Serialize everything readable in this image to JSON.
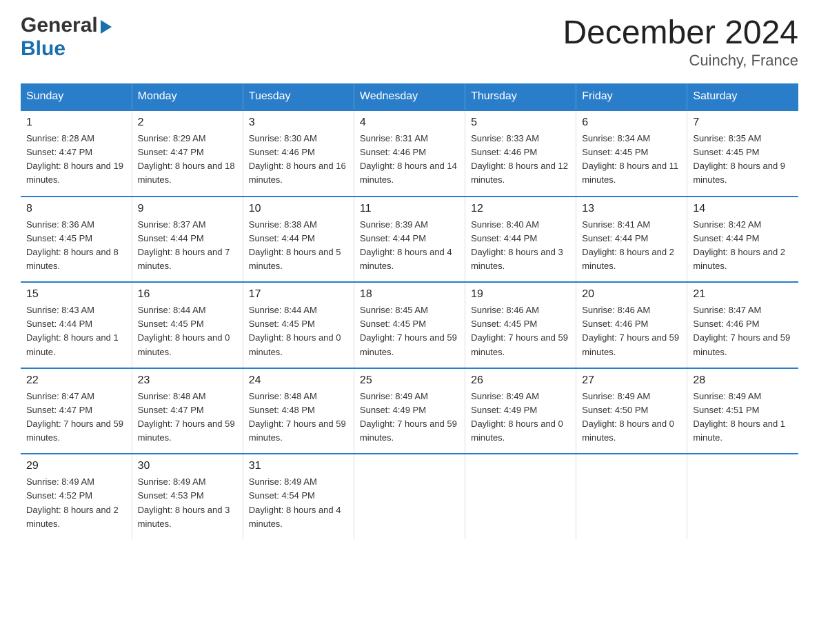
{
  "header": {
    "logo": {
      "general": "General",
      "blue": "Blue",
      "arrow_char": "▶"
    },
    "title": "December 2024",
    "subtitle": "Cuinchy, France"
  },
  "calendar": {
    "days_of_week": [
      "Sunday",
      "Monday",
      "Tuesday",
      "Wednesday",
      "Thursday",
      "Friday",
      "Saturday"
    ],
    "weeks": [
      [
        {
          "day": "1",
          "sunrise": "8:28 AM",
          "sunset": "4:47 PM",
          "daylight": "8 hours and 19 minutes."
        },
        {
          "day": "2",
          "sunrise": "8:29 AM",
          "sunset": "4:47 PM",
          "daylight": "8 hours and 18 minutes."
        },
        {
          "day": "3",
          "sunrise": "8:30 AM",
          "sunset": "4:46 PM",
          "daylight": "8 hours and 16 minutes."
        },
        {
          "day": "4",
          "sunrise": "8:31 AM",
          "sunset": "4:46 PM",
          "daylight": "8 hours and 14 minutes."
        },
        {
          "day": "5",
          "sunrise": "8:33 AM",
          "sunset": "4:46 PM",
          "daylight": "8 hours and 12 minutes."
        },
        {
          "day": "6",
          "sunrise": "8:34 AM",
          "sunset": "4:45 PM",
          "daylight": "8 hours and 11 minutes."
        },
        {
          "day": "7",
          "sunrise": "8:35 AM",
          "sunset": "4:45 PM",
          "daylight": "8 hours and 9 minutes."
        }
      ],
      [
        {
          "day": "8",
          "sunrise": "8:36 AM",
          "sunset": "4:45 PM",
          "daylight": "8 hours and 8 minutes."
        },
        {
          "day": "9",
          "sunrise": "8:37 AM",
          "sunset": "4:44 PM",
          "daylight": "8 hours and 7 minutes."
        },
        {
          "day": "10",
          "sunrise": "8:38 AM",
          "sunset": "4:44 PM",
          "daylight": "8 hours and 5 minutes."
        },
        {
          "day": "11",
          "sunrise": "8:39 AM",
          "sunset": "4:44 PM",
          "daylight": "8 hours and 4 minutes."
        },
        {
          "day": "12",
          "sunrise": "8:40 AM",
          "sunset": "4:44 PM",
          "daylight": "8 hours and 3 minutes."
        },
        {
          "day": "13",
          "sunrise": "8:41 AM",
          "sunset": "4:44 PM",
          "daylight": "8 hours and 2 minutes."
        },
        {
          "day": "14",
          "sunrise": "8:42 AM",
          "sunset": "4:44 PM",
          "daylight": "8 hours and 2 minutes."
        }
      ],
      [
        {
          "day": "15",
          "sunrise": "8:43 AM",
          "sunset": "4:44 PM",
          "daylight": "8 hours and 1 minute."
        },
        {
          "day": "16",
          "sunrise": "8:44 AM",
          "sunset": "4:45 PM",
          "daylight": "8 hours and 0 minutes."
        },
        {
          "day": "17",
          "sunrise": "8:44 AM",
          "sunset": "4:45 PM",
          "daylight": "8 hours and 0 minutes."
        },
        {
          "day": "18",
          "sunrise": "8:45 AM",
          "sunset": "4:45 PM",
          "daylight": "7 hours and 59 minutes."
        },
        {
          "day": "19",
          "sunrise": "8:46 AM",
          "sunset": "4:45 PM",
          "daylight": "7 hours and 59 minutes."
        },
        {
          "day": "20",
          "sunrise": "8:46 AM",
          "sunset": "4:46 PM",
          "daylight": "7 hours and 59 minutes."
        },
        {
          "day": "21",
          "sunrise": "8:47 AM",
          "sunset": "4:46 PM",
          "daylight": "7 hours and 59 minutes."
        }
      ],
      [
        {
          "day": "22",
          "sunrise": "8:47 AM",
          "sunset": "4:47 PM",
          "daylight": "7 hours and 59 minutes."
        },
        {
          "day": "23",
          "sunrise": "8:48 AM",
          "sunset": "4:47 PM",
          "daylight": "7 hours and 59 minutes."
        },
        {
          "day": "24",
          "sunrise": "8:48 AM",
          "sunset": "4:48 PM",
          "daylight": "7 hours and 59 minutes."
        },
        {
          "day": "25",
          "sunrise": "8:49 AM",
          "sunset": "4:49 PM",
          "daylight": "7 hours and 59 minutes."
        },
        {
          "day": "26",
          "sunrise": "8:49 AM",
          "sunset": "4:49 PM",
          "daylight": "8 hours and 0 minutes."
        },
        {
          "day": "27",
          "sunrise": "8:49 AM",
          "sunset": "4:50 PM",
          "daylight": "8 hours and 0 minutes."
        },
        {
          "day": "28",
          "sunrise": "8:49 AM",
          "sunset": "4:51 PM",
          "daylight": "8 hours and 1 minute."
        }
      ],
      [
        {
          "day": "29",
          "sunrise": "8:49 AM",
          "sunset": "4:52 PM",
          "daylight": "8 hours and 2 minutes."
        },
        {
          "day": "30",
          "sunrise": "8:49 AM",
          "sunset": "4:53 PM",
          "daylight": "8 hours and 3 minutes."
        },
        {
          "day": "31",
          "sunrise": "8:49 AM",
          "sunset": "4:54 PM",
          "daylight": "8 hours and 4 minutes."
        },
        {
          "day": "",
          "sunrise": "",
          "sunset": "",
          "daylight": ""
        },
        {
          "day": "",
          "sunrise": "",
          "sunset": "",
          "daylight": ""
        },
        {
          "day": "",
          "sunrise": "",
          "sunset": "",
          "daylight": ""
        },
        {
          "day": "",
          "sunrise": "",
          "sunset": "",
          "daylight": ""
        }
      ]
    ]
  }
}
